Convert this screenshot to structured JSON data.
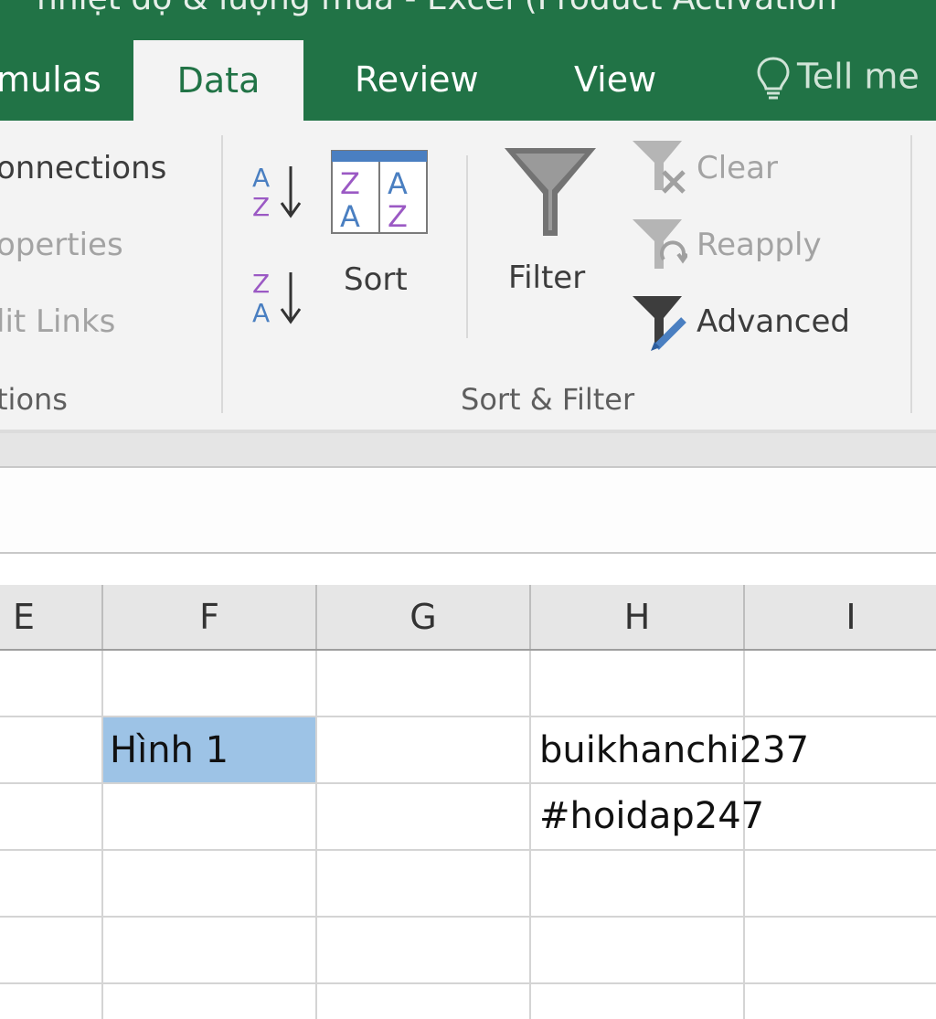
{
  "window": {
    "title": "nhiệt độ & lượng mưa - Excel (Product Activation"
  },
  "tabs": {
    "formulas": "mulas",
    "data": "Data",
    "review": "Review",
    "view": "View",
    "tell_me": "Tell me"
  },
  "ribbon": {
    "connections_group": {
      "connections": "onnections",
      "properties": "operties",
      "edit_links": "lit Links",
      "group_label": "tions"
    },
    "sort_filter_group": {
      "sort_label": "Sort",
      "filter_label": "Filter",
      "clear_label": "Clear",
      "reapply_label": "Reapply",
      "advanced_label": "Advanced",
      "group_label": "Sort & Filter",
      "sort_icon_letters": {
        "top": "Z",
        "bottom": "A",
        "alt_top": "A",
        "alt_bottom": "Z"
      }
    }
  },
  "grid": {
    "columns": [
      "E",
      "F",
      "G",
      "H",
      "I"
    ],
    "cells": {
      "f2": "Hình 1",
      "h2": "buikhanchi237",
      "h3": "#hoidap247"
    }
  },
  "colors": {
    "excel_green": "#217346",
    "ribbon_bg": "#f3f3f3",
    "selected_cell": "#9dc3e6"
  }
}
